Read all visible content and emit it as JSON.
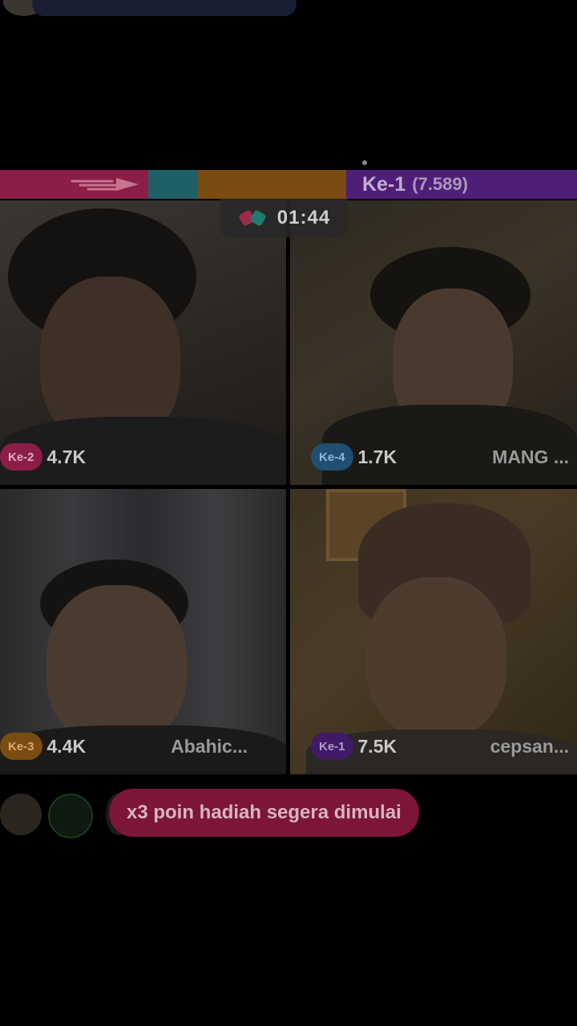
{
  "battle": {
    "leader_rank": "Ke-1",
    "leader_points": "(7.589)",
    "timer": "01:44",
    "colors": {
      "pink": "#8a1e47",
      "teal": "#1f6068",
      "orange": "#7a4c12",
      "purple": "#4f1e78"
    }
  },
  "tiles": [
    {
      "rank": "Ke-2",
      "score": "4.7K",
      "name": "",
      "badge_bg": "#8a1e47",
      "badge_fg": "#e3a9bd"
    },
    {
      "rank": "Ke-4",
      "score": "1.7K",
      "name": "MANG ...",
      "badge_bg": "#1f4f72",
      "badge_fg": "#8fb7d6"
    },
    {
      "rank": "Ke-3",
      "score": "4.4K",
      "name": "Abahic...",
      "badge_bg": "#7a4c12",
      "badge_fg": "#d7ab72"
    },
    {
      "rank": "Ke-1",
      "score": "7.5K",
      "name": "cepsan...",
      "badge_bg": "#3f1a66",
      "badge_fg": "#b49ad0"
    }
  ],
  "hint": "x3 poin hadiah segera dimulai"
}
